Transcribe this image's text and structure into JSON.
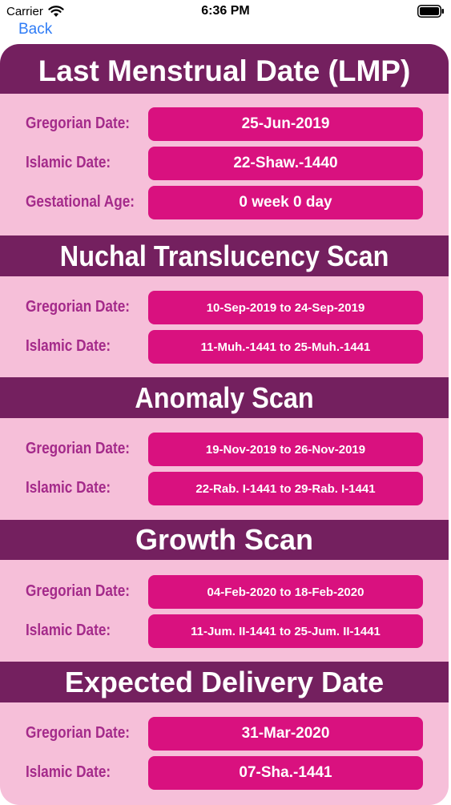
{
  "status": {
    "carrier": "Carrier",
    "time": "6:36 PM"
  },
  "nav": {
    "back_label": "Back"
  },
  "sections": {
    "lmp": {
      "title": "Last Menstrual Date (LMP)",
      "gregorian_label": "Gregorian Date:",
      "gregorian_value": "25-Jun-2019",
      "islamic_label": "Islamic Date:",
      "islamic_value": "22-Shaw.-1440",
      "ga_label": "Gestational Age:",
      "ga_value": "0 week 0 day"
    },
    "nt": {
      "title": "Nuchal Translucency Scan",
      "gregorian_label": "Gregorian Date:",
      "gregorian_value": "10-Sep-2019 to 24-Sep-2019",
      "islamic_label": "Islamic Date:",
      "islamic_value": "11-Muh.-1441 to 25-Muh.-1441"
    },
    "anomaly": {
      "title": "Anomaly Scan",
      "gregorian_label": "Gregorian Date:",
      "gregorian_value": "19-Nov-2019 to 26-Nov-2019",
      "islamic_label": "Islamic Date:",
      "islamic_value": "22-Rab. I-1441 to 29-Rab. I-1441"
    },
    "growth": {
      "title": "Growth Scan",
      "gregorian_label": "Gregorian Date:",
      "gregorian_value": "04-Feb-2020 to 18-Feb-2020",
      "islamic_label": "Islamic Date:",
      "islamic_value": "11-Jum. II-1441 to 25-Jum. II-1441"
    },
    "edd": {
      "title": "Expected Delivery Date",
      "gregorian_label": "Gregorian Date:",
      "gregorian_value": "31-Mar-2020",
      "islamic_label": "Islamic Date:",
      "islamic_value": "07-Sha.-1441"
    }
  },
  "colors": {
    "header_bg": "#74205f",
    "card_bg": "#f6bfd9",
    "pill_bg": "#d9117f",
    "label_text": "#a42a8a",
    "back_link": "#2f7cf6"
  },
  "icons": {
    "wifi": "wifi-icon",
    "battery": "battery-icon"
  }
}
